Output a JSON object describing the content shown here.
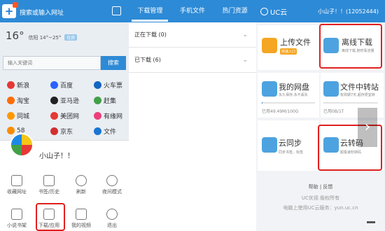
{
  "panel1": {
    "url_placeholder": "搜索或输入网址",
    "weather": {
      "deg": "16°",
      "location": "信阳 14°~25°",
      "quality": "优良"
    },
    "search_placeholder": "输入关键词",
    "search_button": "搜索",
    "sites": [
      "新浪",
      "百度",
      "火车票",
      "淘宝",
      "亚马逊",
      "赶集",
      "同城",
      "美团网",
      "有缘网",
      "58",
      "京东",
      "文件"
    ],
    "username": "小山子！！",
    "menu": [
      "收藏网址",
      "书签/历史",
      "刷新",
      "夜间模式",
      "小说书架",
      "下载/应用",
      "我的视频",
      "退出"
    ]
  },
  "panel2": {
    "tabs": [
      "下载管理",
      "手机文件",
      "热门资源"
    ],
    "downloading": "正在下载 (0)",
    "downloaded": "已下载 (6)"
  },
  "panel3": {
    "brand": "UC云",
    "user": "小山子！！(12052444)",
    "upload": {
      "title": "上传文件",
      "badge": "快速入口"
    },
    "offline": {
      "title": "离线下载",
      "sub": "离线下载,随时看流量"
    },
    "disk": {
      "title": "我的网盘",
      "sub": "永久保存,永不丢失",
      "quota": "已用49.49M/100G",
      "used_fraction": 0.0005
    },
    "transfer": {
      "title": "文件中转站",
      "sub": "有效期7天,超存便宜转",
      "quota": "已用0B/1T",
      "used_fraction": 0
    },
    "sync": {
      "title": "云同步",
      "sub": "同步书签、标签"
    },
    "transcode": {
      "title": "云转码",
      "sub": "超极速秒转码"
    },
    "help": "帮助 | 反馈",
    "copyright": "UC优视 版权所有",
    "pc_hint": "电脑上使用UC云服务：yun.uc.cn"
  },
  "colors": {
    "primary": "#2d8ad6",
    "highlight": "#e02020"
  }
}
